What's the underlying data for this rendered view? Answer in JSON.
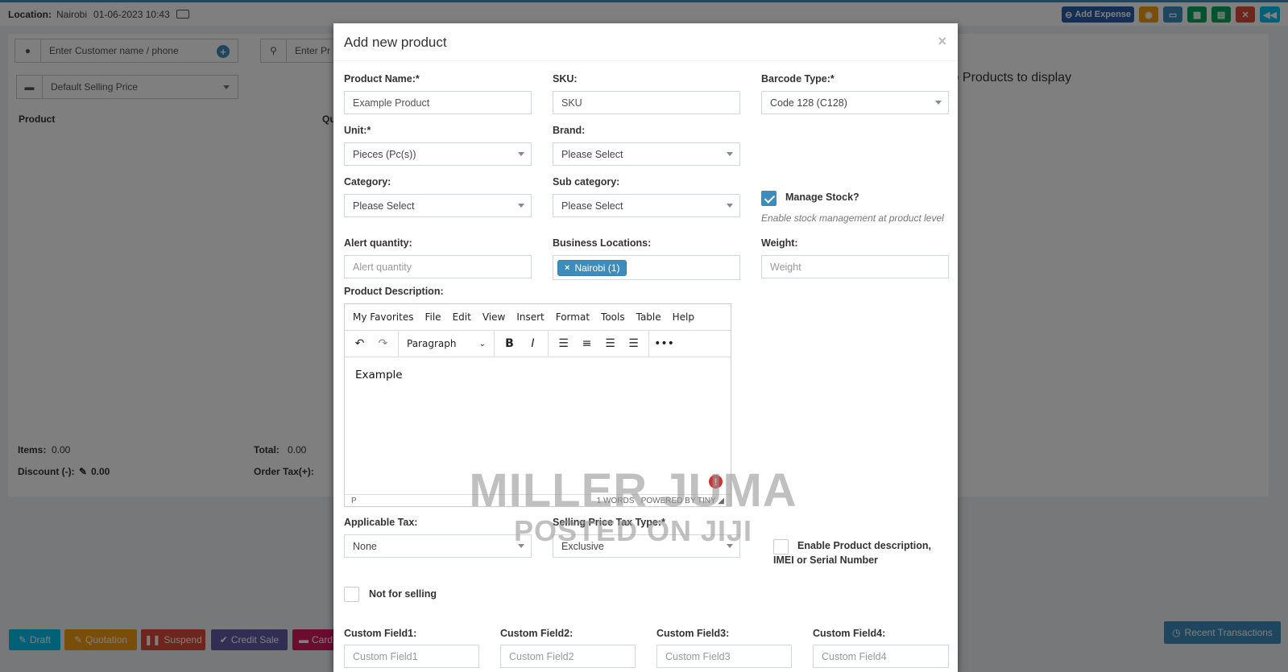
{
  "background": {
    "location_label": "Location:",
    "location_value": "Nairobi",
    "datetime": "01-06-2023 10:43",
    "add_expense_label": "Add Expense",
    "customer_placeholder": "Enter Customer name / phone",
    "product_search_placeholder": "Enter Pr",
    "price_group": "Default Selling Price",
    "product_col": "Product",
    "qty_col": "Qu",
    "no_products": "No Products to display",
    "items_label": "Items:",
    "items_value": "0.00",
    "total_label": "Total:",
    "total_value": "0.00",
    "discount_label": "Discount (-):",
    "discount_value": "0.00",
    "order_tax_label": "Order Tax(+):",
    "buttons": {
      "draft": "Draft",
      "quotation": "Quotation",
      "suspend": "Suspend",
      "credit_sale": "Credit Sale",
      "card": "Card",
      "recent_transactions": "Recent Transactions"
    }
  },
  "modal": {
    "title": "Add new product",
    "close": "×",
    "product_name": {
      "label": "Product Name:*",
      "value": "Example Product"
    },
    "sku": {
      "label": "SKU:",
      "placeholder": "SKU"
    },
    "barcode_type": {
      "label": "Barcode Type:*",
      "value": "Code 128 (C128)"
    },
    "unit": {
      "label": "Unit:*",
      "value": "Pieces (Pc(s))"
    },
    "brand": {
      "label": "Brand:",
      "value": "Please Select"
    },
    "category": {
      "label": "Category:",
      "value": "Please Select"
    },
    "sub_category": {
      "label": "Sub category:",
      "value": "Please Select"
    },
    "manage_stock": {
      "label": "Manage Stock?",
      "checked": true,
      "help": "Enable stock management at product level"
    },
    "alert_quantity": {
      "label": "Alert quantity:",
      "placeholder": "Alert quantity"
    },
    "business_locations": {
      "label": "Business Locations:",
      "chip_remove": "×",
      "chip": "Nairobi (1)"
    },
    "weight": {
      "label": "Weight:",
      "placeholder": "Weight"
    },
    "description": {
      "label": "Product Description:",
      "menu": [
        "My Favorites",
        "File",
        "Edit",
        "View",
        "Insert",
        "Format",
        "Tools",
        "Table",
        "Help"
      ],
      "block_format": "Paragraph",
      "content": "Example",
      "status_path": "P",
      "word_count": "1 WORDS",
      "powered": "POWERED BY TINY"
    },
    "applicable_tax": {
      "label": "Applicable Tax:",
      "value": "None"
    },
    "selling_price_tax_type": {
      "label": "Selling Price Tax Type:*",
      "value": "Exclusive"
    },
    "enable_desc": {
      "label": "Enable Product description, IMEI or Serial Number",
      "checked": false
    },
    "not_for_selling": {
      "label": "Not for selling",
      "checked": false
    },
    "custom_fields": [
      {
        "label": "Custom Field1:",
        "placeholder": "Custom Field1"
      },
      {
        "label": "Custom Field2:",
        "placeholder": "Custom Field2"
      },
      {
        "label": "Custom Field3:",
        "placeholder": "Custom Field3"
      },
      {
        "label": "Custom Field4:",
        "placeholder": "Custom Field4"
      }
    ]
  },
  "watermark": {
    "line1": "MILLER JUMA",
    "line2": "POSTED ON JIJI"
  },
  "colors": {
    "primary": "#3c8dbc",
    "error": "#d32f2f"
  }
}
